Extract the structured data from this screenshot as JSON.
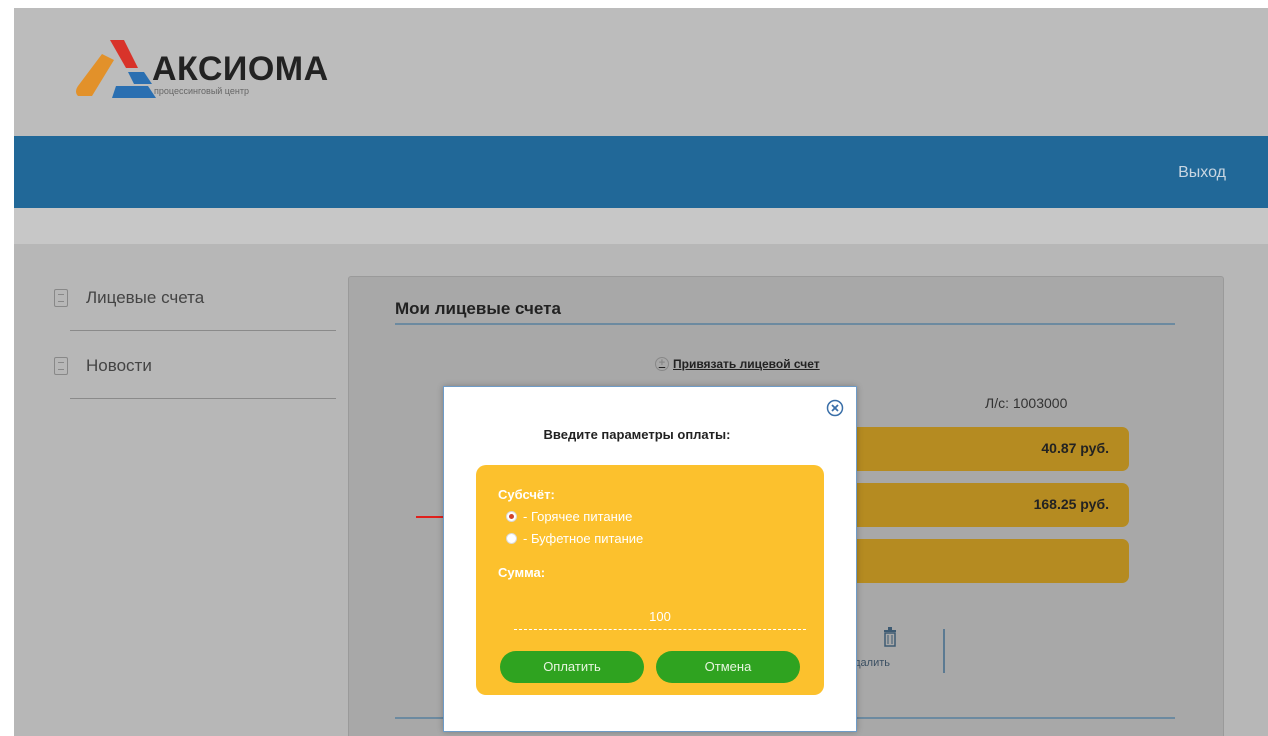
{
  "header": {
    "brand_name": "АКСИОМА",
    "brand_tagline": "процессинговый центр",
    "logout_label": "Выход"
  },
  "sidebar": {
    "items": [
      {
        "label": "Лицевые счета",
        "icon": "document-icon"
      },
      {
        "label": "Новости",
        "icon": "news-icon"
      }
    ]
  },
  "main": {
    "title": "Мои лицевые счета",
    "bind_account_label": "Привязать лицевой счет",
    "account_number": "Л/с: 1003000",
    "balances": [
      "40.87 руб.",
      "168.25 руб.",
      ""
    ],
    "delete_label": "удалить"
  },
  "modal": {
    "title": "Введите параметры оплаты:",
    "subaccount_label": "Субсчёт:",
    "options": [
      {
        "label": "- Горячее питание",
        "selected": true
      },
      {
        "label": "- Буфетное питание",
        "selected": false
      }
    ],
    "amount_label": "Сумма:",
    "amount_value": "100",
    "pay_button": "Оплатить",
    "cancel_button": "Отмена"
  },
  "colors": {
    "nav_bar": "#216898",
    "pay_box": "#fcc12d",
    "balance_bar": "#b58b21",
    "button_green": "#2fa320",
    "annotation_arrow": "#e0201c"
  }
}
